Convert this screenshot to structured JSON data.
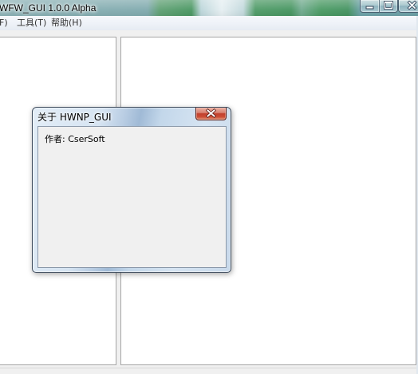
{
  "window": {
    "title": "WFW_GUI 1.0.0 Alpha",
    "icons": {
      "minimize": "minimize-icon",
      "maximize": "maximize-icon",
      "close": "close-icon"
    }
  },
  "menu": {
    "items": [
      {
        "label": "F)"
      },
      {
        "label": "工具(T)"
      },
      {
        "label": "帮助(H)"
      }
    ]
  },
  "dialog": {
    "title": "关于 HWNP_GUI",
    "author_text": "作者: CserSoft",
    "close_icon": "close-icon"
  },
  "colors": {
    "client_bg": "#f0f0f0",
    "panel_bg": "#ffffff",
    "panel_border": "#a5a5a5",
    "dialog_close": "#c2402d"
  }
}
